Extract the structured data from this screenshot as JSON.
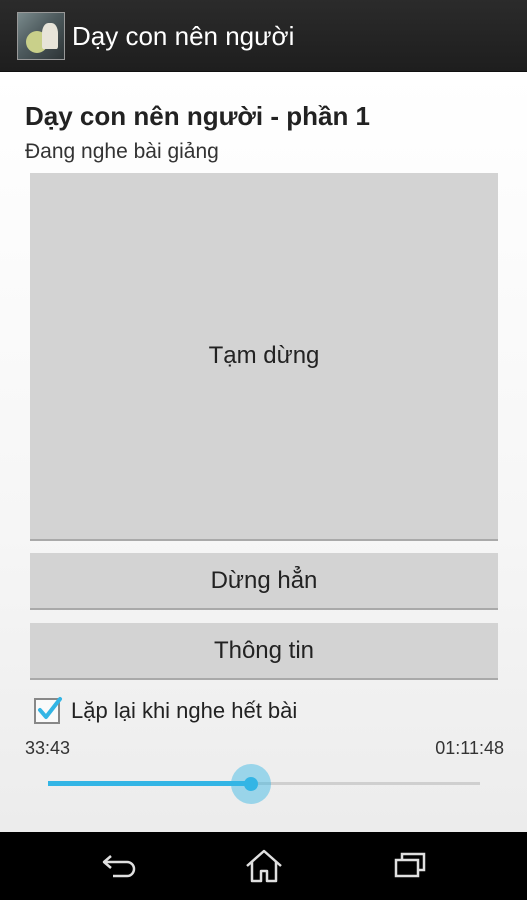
{
  "app": {
    "title": "Dạy con nên người",
    "icon": "app-icon-image"
  },
  "header": {
    "title": "Dạy con nên người - phần 1",
    "status": "Đang nghe bài giảng"
  },
  "controls": {
    "pause_label": "Tạm dừng",
    "stop_label": "Dừng hẳn",
    "info_label": "Thông tin"
  },
  "repeat": {
    "label": "Lặp lại khi nghe hết bài",
    "checked": true
  },
  "player": {
    "current_time": "33:43",
    "total_time": "01:11:48",
    "progress_fraction": 0.4695
  },
  "navbar": {
    "icons": [
      "back-icon",
      "home-icon",
      "recent-apps-icon"
    ]
  },
  "colors": {
    "accent": "#33b5e5",
    "button_bg": "#d3d3d3",
    "actionbar_bg": "#222222"
  }
}
